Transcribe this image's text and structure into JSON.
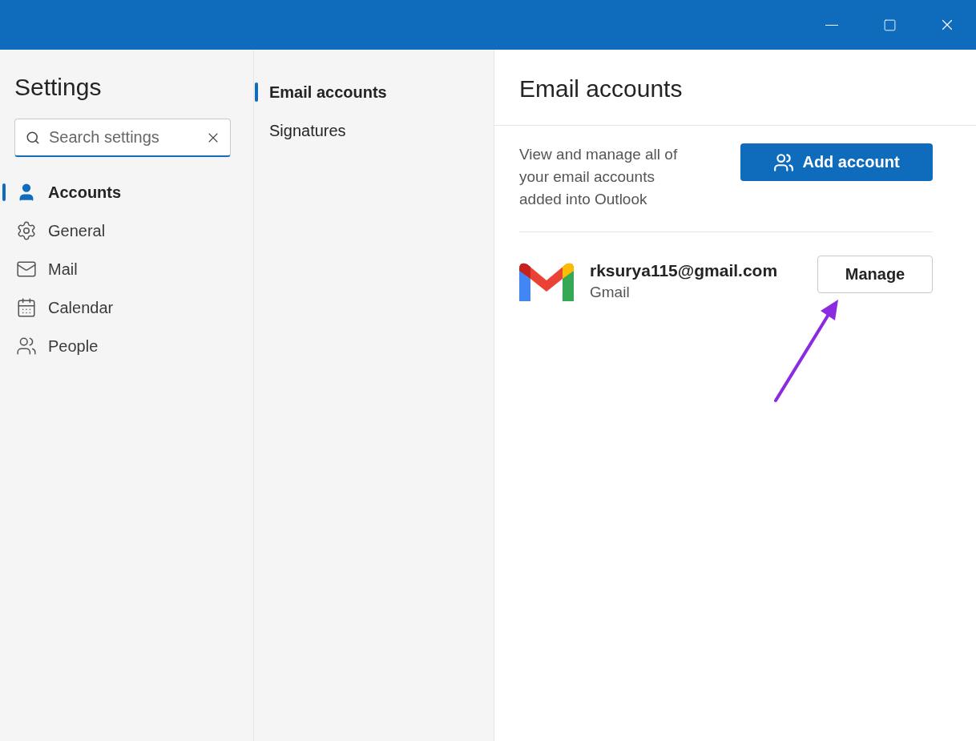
{
  "sidebar": {
    "title": "Settings",
    "search": {
      "placeholder": "Search settings"
    },
    "items": [
      {
        "label": "Accounts",
        "kind": "person",
        "selected": true
      },
      {
        "label": "General",
        "kind": "gear",
        "selected": false
      },
      {
        "label": "Mail",
        "kind": "mail",
        "selected": false
      },
      {
        "label": "Calendar",
        "kind": "calendar",
        "selected": false
      },
      {
        "label": "People",
        "kind": "people",
        "selected": false
      }
    ]
  },
  "subnav": {
    "items": [
      {
        "label": "Email accounts",
        "selected": true
      },
      {
        "label": "Signatures",
        "selected": false
      }
    ]
  },
  "content": {
    "title": "Email accounts",
    "description": "View and manage all of your email accounts added into Outlook",
    "add_button": "Add account",
    "accounts": [
      {
        "email": "rksurya115@gmail.com",
        "provider": "Gmail",
        "manage_button": "Manage"
      }
    ]
  }
}
